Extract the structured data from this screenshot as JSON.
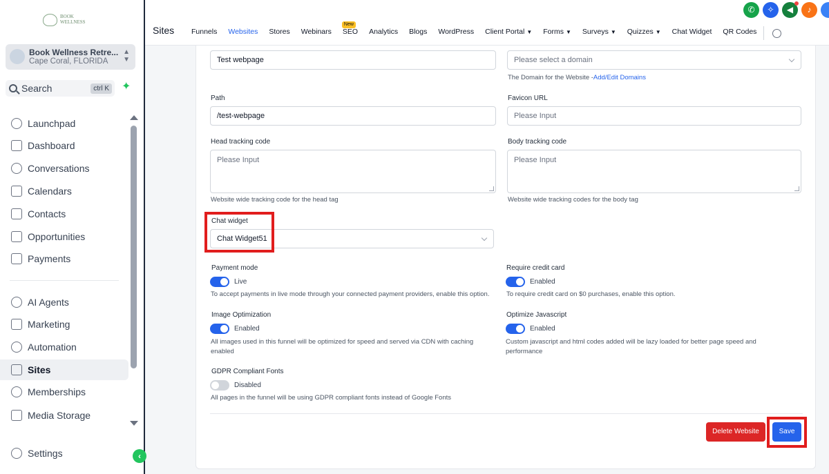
{
  "brand": {
    "logo_text": "BOOK WELLNESS"
  },
  "account": {
    "name": "Book Wellness Retre...",
    "location": "Cape Coral, FLORIDA"
  },
  "search": {
    "label": "Search",
    "shortcut": "ctrl K"
  },
  "nav": {
    "items": [
      {
        "label": "Launchpad"
      },
      {
        "label": "Dashboard"
      },
      {
        "label": "Conversations"
      },
      {
        "label": "Calendars"
      },
      {
        "label": "Contacts"
      },
      {
        "label": "Opportunities"
      },
      {
        "label": "Payments"
      },
      {
        "label": "AI Agents"
      },
      {
        "label": "Marketing"
      },
      {
        "label": "Automation"
      },
      {
        "label": "Sites"
      },
      {
        "label": "Memberships"
      },
      {
        "label": "Media Storage"
      },
      {
        "label": "Settings"
      }
    ]
  },
  "header": {
    "title": "Sites",
    "tabs": [
      {
        "label": "Funnels"
      },
      {
        "label": "Websites"
      },
      {
        "label": "Stores"
      },
      {
        "label": "Webinars"
      },
      {
        "label": "SEO",
        "badge": "New"
      },
      {
        "label": "Analytics"
      },
      {
        "label": "Blogs"
      },
      {
        "label": "WordPress"
      },
      {
        "label": "Client Portal"
      },
      {
        "label": "Forms"
      },
      {
        "label": "Surveys"
      },
      {
        "label": "Quizzes"
      },
      {
        "label": "Chat Widget"
      },
      {
        "label": "QR Codes"
      }
    ]
  },
  "form": {
    "name_value": "Test webpage",
    "domain_placeholder": "Please select a domain",
    "domain_help": "The Domain for the Website -",
    "domain_link": "Add/Edit Domains",
    "path_label": "Path",
    "path_value": "/test-webpage",
    "favicon_label": "Favicon URL",
    "favicon_placeholder": "Please Input",
    "head_label": "Head tracking code",
    "head_placeholder": "Please Input",
    "head_help": "Website wide tracking code for the head tag",
    "body_label": "Body tracking code",
    "body_placeholder": "Please Input",
    "body_help": "Website wide tracking codes for the body tag",
    "chat_label": "Chat widget",
    "chat_value": "Chat Widget51",
    "payment_label": "Payment mode",
    "payment_state": "Live",
    "payment_help": "To accept payments in live mode through your connected payment providers, enable this option.",
    "credit_label": "Require credit card",
    "credit_state": "Enabled",
    "credit_help": "To require credit card on $0 purchases, enable this option.",
    "image_label": "Image Optimization",
    "image_state": "Enabled",
    "image_help": "All images used in this funnel will be optimized for speed and served via CDN with caching enabled",
    "js_label": "Optimize Javascript",
    "js_state": "Enabled",
    "js_help": "Custom javascript and html codes added will be lazy loaded for better page speed and performance",
    "gdpr_label": "GDPR Compliant Fonts",
    "gdpr_state": "Disabled",
    "gdpr_help": "All pages in the funnel will be using GDPR compliant fonts instead of Google Fonts"
  },
  "actions": {
    "delete_label": "Delete Website",
    "save_label": "Save"
  },
  "colors": {
    "accent": "#2563eb",
    "danger": "#dc2626",
    "highlight": "#e11d1d"
  }
}
